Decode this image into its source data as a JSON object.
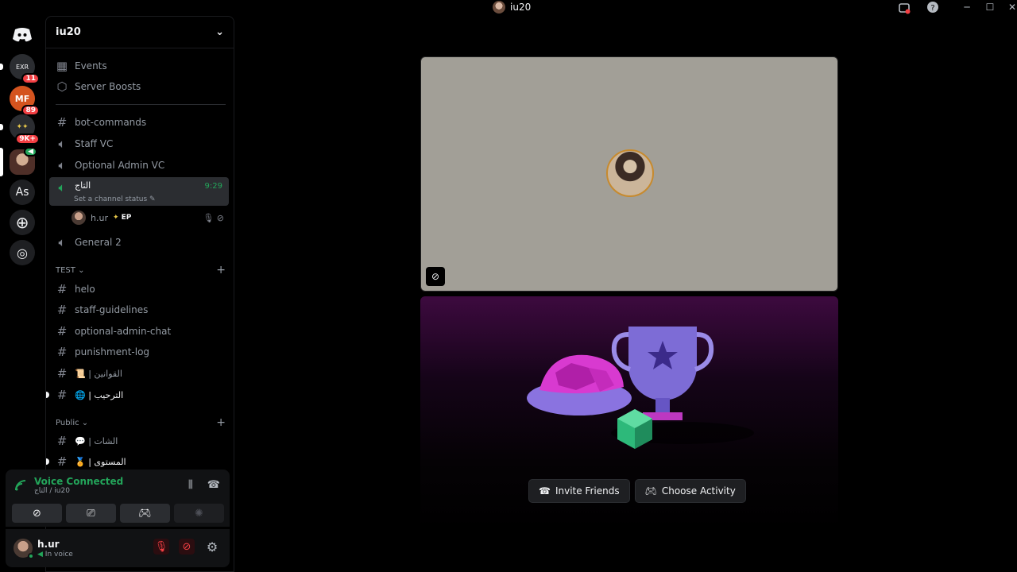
{
  "window": {
    "title": "iu20"
  },
  "rail": {
    "badges": [
      "11",
      "89",
      "9K+"
    ],
    "as_label": "As"
  },
  "server": {
    "name": "iu20"
  },
  "channels": {
    "events": "Events",
    "boosts": "Server Boosts",
    "bot_commands": "bot-commands",
    "staff_vc": "Staff VC",
    "optional_admin_vc": "Optional Admin VC",
    "active_voice": "التاج",
    "active_time": "9:29",
    "active_status": "Set a channel status",
    "voice_user": "h.ur",
    "voice_user_tag": "EP",
    "general2": "General 2",
    "cat_test": "TEST",
    "helo": "helo",
    "staff_guidelines": "staff-guidelines",
    "optional_admin_chat": "optional-admin-chat",
    "punishment_log": "punishment-log",
    "rules": "📜 | القوانين",
    "welcome": "🌐 | الترحيب",
    "cat_public": "Public",
    "chat": "💬 | الشات",
    "level": "🏅 | المستوى"
  },
  "voice_panel": {
    "title": "Voice Connected",
    "subtitle": "التاج / iu20"
  },
  "user": {
    "name": "h.ur",
    "status": "In voice"
  },
  "activity": {
    "invite_label": "Invite Friends",
    "choose_label": "Choose Activity"
  },
  "colors": {
    "accent_green": "#23a55a",
    "danger_red": "#f23f43",
    "video_tile_bg": "#a29f97",
    "activity_purple": "#3d0a3f"
  }
}
